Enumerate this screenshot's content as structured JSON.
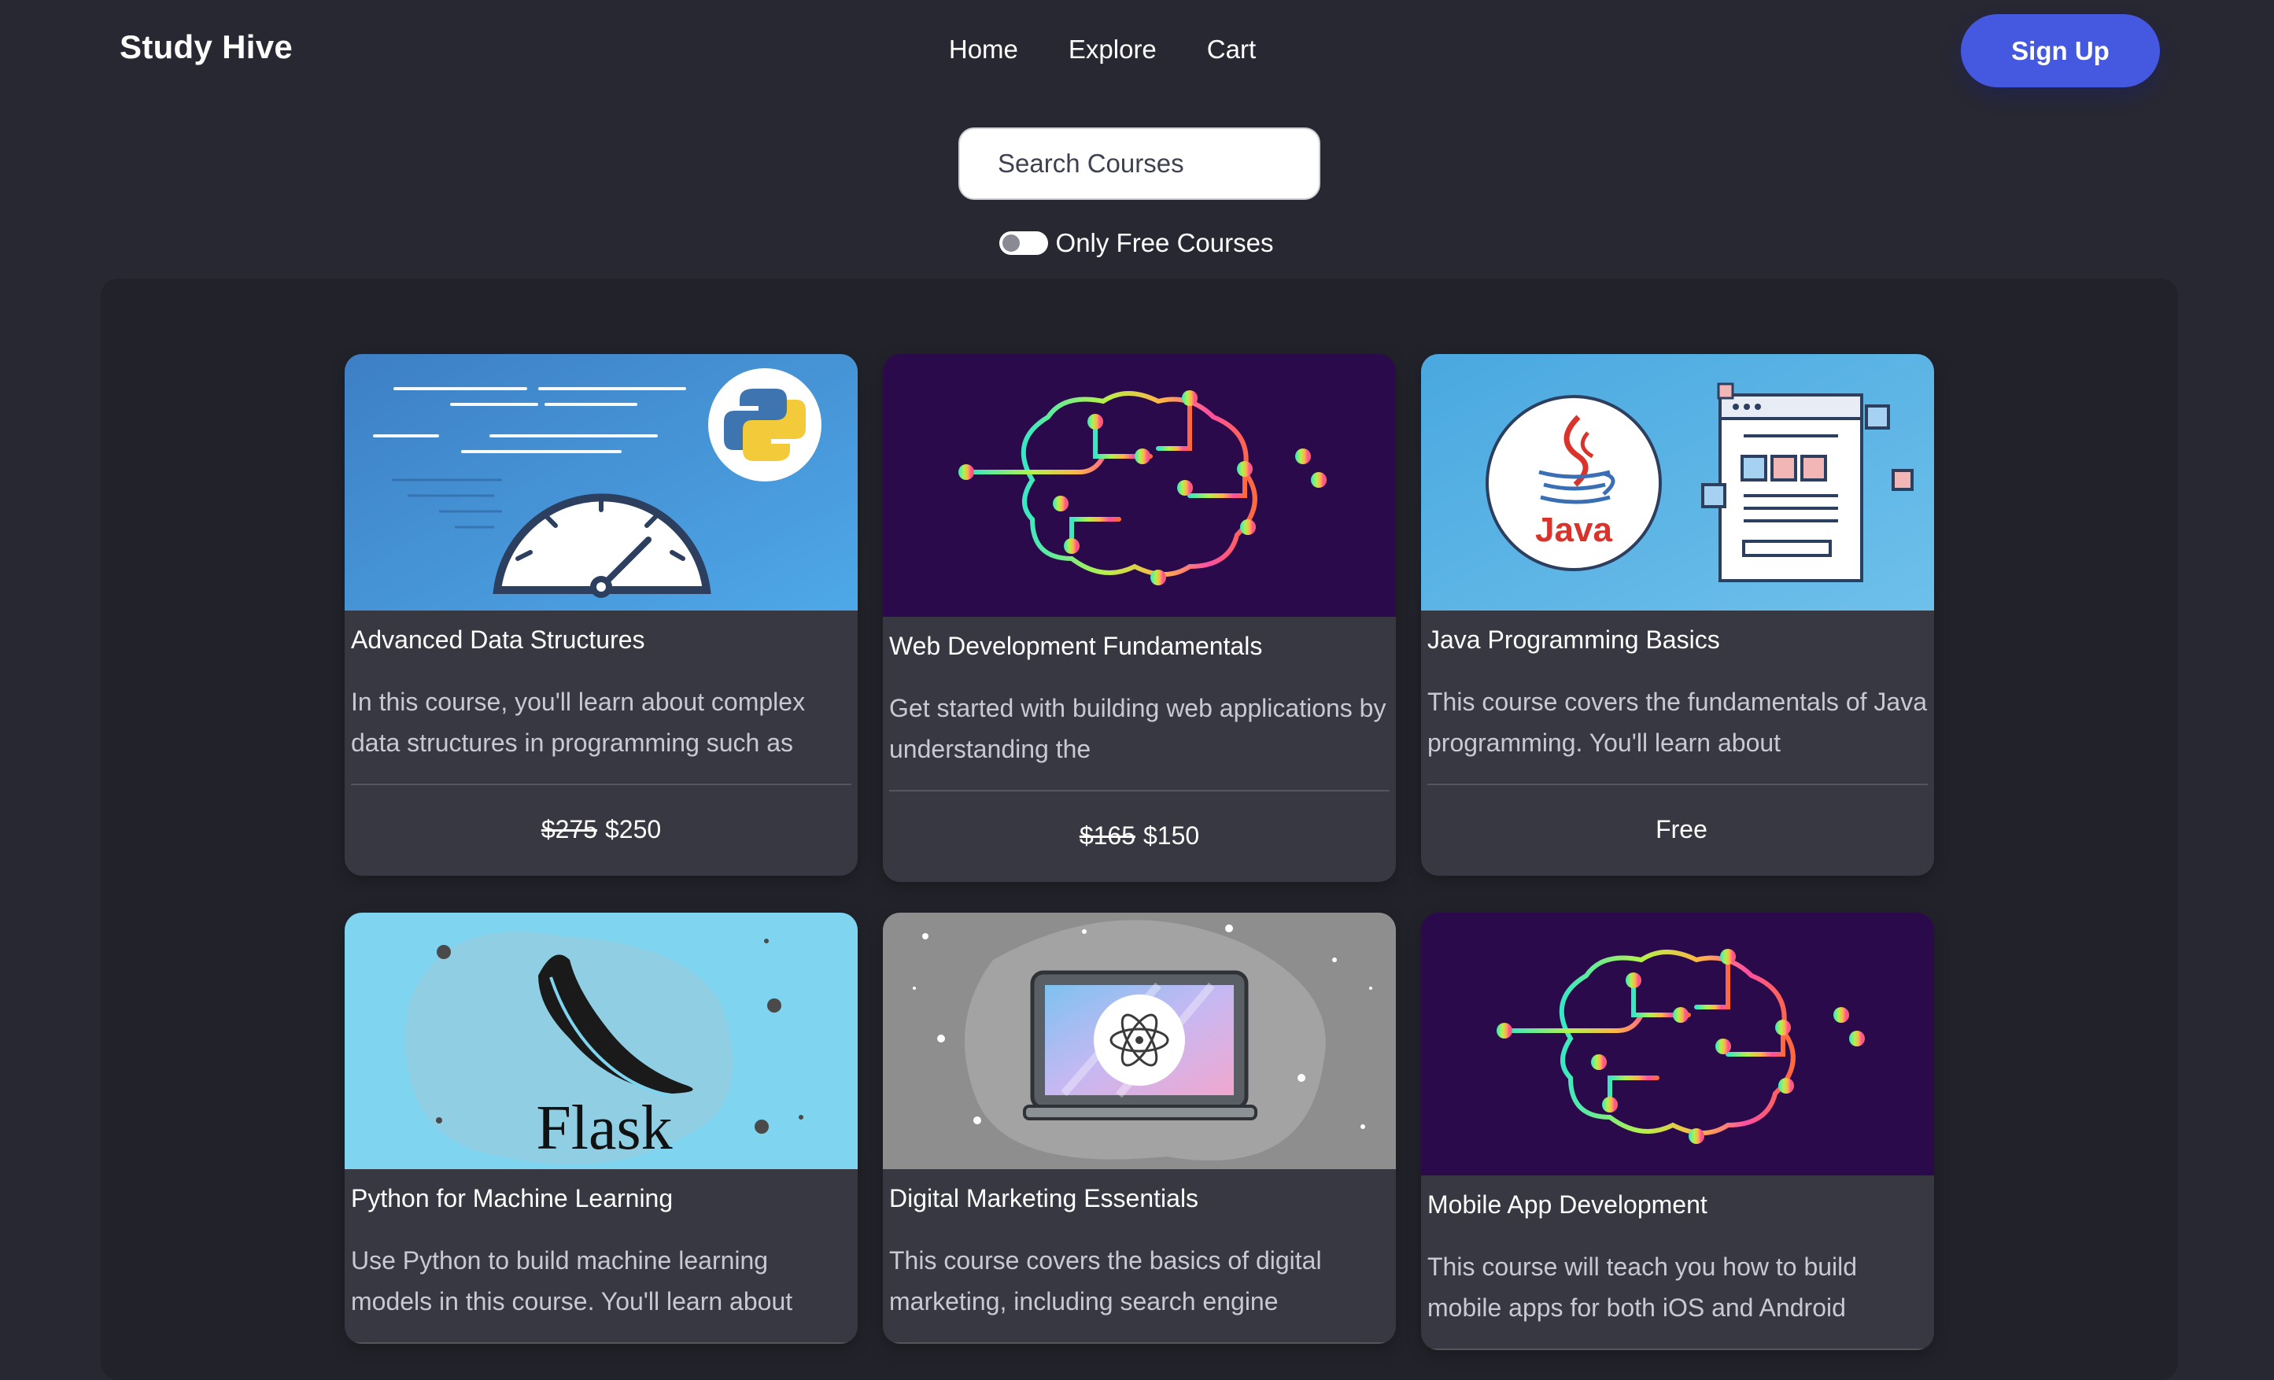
{
  "header": {
    "brand": "Study Hive",
    "nav": [
      "Home",
      "Explore",
      "Cart"
    ],
    "signup_label": "Sign Up"
  },
  "search": {
    "placeholder": "Search Courses"
  },
  "filter": {
    "label": "Only Free Courses",
    "checked": false
  },
  "courses": [
    {
      "title": "Advanced Data Structures",
      "description": "In this course, you'll learn about complex data structures in programming such as",
      "old_price": "$275",
      "price": "$250",
      "image": "python-speedometer-illustration"
    },
    {
      "title": "Web Development Fundamentals",
      "description": "Get started with building web applications by understanding the",
      "old_price": "$165",
      "price": "$150",
      "image": "neon-circuit-brain-illustration"
    },
    {
      "title": "Java Programming Basics",
      "description": "This course covers the fundamentals of Java programming. You'll learn about",
      "old_price": "",
      "price": "Free",
      "image": "java-logo-illustration",
      "image_text": "Java"
    },
    {
      "title": "Python for Machine Learning",
      "description": "Use Python to build machine learning models in this course. You'll learn about",
      "old_price": "",
      "price": "",
      "image": "flask-logo-illustration",
      "image_text": "Flask"
    },
    {
      "title": "Digital Marketing Essentials",
      "description": "This course covers the basics of digital marketing, including search engine",
      "old_price": "",
      "price": "",
      "image": "laptop-atom-illustration"
    },
    {
      "title": "Mobile App Development",
      "description": "This course will teach you how to build mobile apps for both iOS and Android",
      "old_price": "",
      "price": "",
      "image": "neon-circuit-brain-illustration"
    }
  ],
  "colors": {
    "page_bg": "#282833",
    "panel_bg": "#22222a",
    "card_bg": "#383843",
    "accent": "#4458e0"
  }
}
